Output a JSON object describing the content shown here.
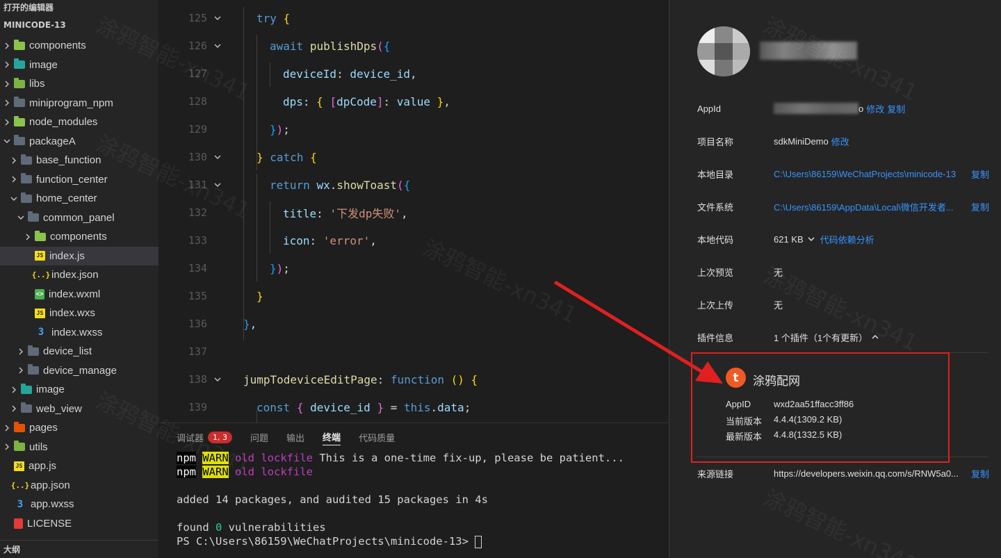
{
  "sidebar": {
    "open_editors": "打开的编辑器",
    "project": "MINICODE-13",
    "outline": "大纲",
    "tree": [
      {
        "label": "components",
        "depth": 0,
        "icon": "folder-green",
        "chev": "right"
      },
      {
        "label": "image",
        "depth": 0,
        "icon": "folder-teal",
        "chev": "right"
      },
      {
        "label": "libs",
        "depth": 0,
        "icon": "folder-lime",
        "chev": "right"
      },
      {
        "label": "miniprogram_npm",
        "depth": 0,
        "icon": "folder",
        "chev": "right"
      },
      {
        "label": "node_modules",
        "depth": 0,
        "icon": "folder-green",
        "chev": "right"
      },
      {
        "label": "packageA",
        "depth": 0,
        "icon": "folder",
        "chev": "down"
      },
      {
        "label": "base_function",
        "depth": 1,
        "icon": "folder",
        "chev": "right"
      },
      {
        "label": "function_center",
        "depth": 1,
        "icon": "folder",
        "chev": "right"
      },
      {
        "label": "home_center",
        "depth": 1,
        "icon": "folder",
        "chev": "down"
      },
      {
        "label": "common_panel",
        "depth": 2,
        "icon": "folder",
        "chev": "down"
      },
      {
        "label": "components",
        "depth": 3,
        "icon": "folder-green",
        "chev": "right"
      },
      {
        "label": "index.js",
        "depth": 3,
        "icon": "js",
        "chev": "none",
        "selected": true
      },
      {
        "label": "index.json",
        "depth": 3,
        "icon": "json",
        "chev": "none"
      },
      {
        "label": "index.wxml",
        "depth": 3,
        "icon": "wxml",
        "chev": "none"
      },
      {
        "label": "index.wxs",
        "depth": 3,
        "icon": "js",
        "chev": "none"
      },
      {
        "label": "index.wxss",
        "depth": 3,
        "icon": "css",
        "chev": "none"
      },
      {
        "label": "device_list",
        "depth": 2,
        "icon": "folder",
        "chev": "right"
      },
      {
        "label": "device_manage",
        "depth": 2,
        "icon": "folder",
        "chev": "right"
      },
      {
        "label": "image",
        "depth": 1,
        "icon": "folder-teal",
        "chev": "right"
      },
      {
        "label": "web_view",
        "depth": 1,
        "icon": "folder",
        "chev": "right"
      },
      {
        "label": "pages",
        "depth": 0,
        "icon": "folder-orange",
        "chev": "right"
      },
      {
        "label": "utils",
        "depth": 0,
        "icon": "folder-lime",
        "chev": "right"
      },
      {
        "label": "app.js",
        "depth": 0,
        "icon": "js",
        "chev": "none"
      },
      {
        "label": "app.json",
        "depth": 0,
        "icon": "json",
        "chev": "none"
      },
      {
        "label": "app.wxss",
        "depth": 0,
        "icon": "css",
        "chev": "none"
      },
      {
        "label": "LICENSE",
        "depth": 0,
        "icon": "license",
        "chev": "none"
      }
    ]
  },
  "editor": {
    "lines": [
      {
        "n": "125",
        "fold": true,
        "indent": 1,
        "tokens": [
          [
            "kw",
            "try"
          ],
          [
            "plain",
            " "
          ],
          [
            "br1",
            "{"
          ]
        ]
      },
      {
        "n": "126",
        "fold": true,
        "indent": 2,
        "tokens": [
          [
            "kw",
            "await"
          ],
          [
            "plain",
            " "
          ],
          [
            "fn",
            "publishDps"
          ],
          [
            "br2",
            "("
          ],
          [
            "br3",
            "{"
          ]
        ]
      },
      {
        "n": "127",
        "fold": false,
        "indent": 3,
        "tokens": [
          [
            "prop",
            "deviceId"
          ],
          [
            "plain",
            ": "
          ],
          [
            "prop",
            "device_id"
          ],
          [
            "plain",
            ","
          ]
        ]
      },
      {
        "n": "128",
        "fold": false,
        "indent": 3,
        "tokens": [
          [
            "prop",
            "dps"
          ],
          [
            "plain",
            ": "
          ],
          [
            "br1",
            "{"
          ],
          [
            "plain",
            " "
          ],
          [
            "br2",
            "["
          ],
          [
            "prop",
            "dpCode"
          ],
          [
            "br2",
            "]"
          ],
          [
            "plain",
            ": "
          ],
          [
            "prop",
            "value"
          ],
          [
            "plain",
            " "
          ],
          [
            "br1",
            "}"
          ],
          [
            "plain",
            ","
          ]
        ]
      },
      {
        "n": "129",
        "fold": false,
        "indent": 2,
        "tokens": [
          [
            "br3",
            "}"
          ],
          [
            "br2",
            ")"
          ],
          [
            "plain",
            ";"
          ]
        ]
      },
      {
        "n": "130",
        "fold": true,
        "indent": 1,
        "tokens": [
          [
            "br1",
            "}"
          ],
          [
            "plain",
            " "
          ],
          [
            "kw",
            "catch"
          ],
          [
            "plain",
            " "
          ],
          [
            "br1",
            "{"
          ]
        ]
      },
      {
        "n": "131",
        "fold": true,
        "indent": 2,
        "tokens": [
          [
            "kw",
            "return"
          ],
          [
            "plain",
            " "
          ],
          [
            "prop",
            "wx"
          ],
          [
            "plain",
            "."
          ],
          [
            "fn",
            "showToast"
          ],
          [
            "br2",
            "("
          ],
          [
            "br3",
            "{"
          ]
        ]
      },
      {
        "n": "132",
        "fold": false,
        "indent": 3,
        "tokens": [
          [
            "prop",
            "title"
          ],
          [
            "plain",
            ": "
          ],
          [
            "str",
            "'下发dp失败'"
          ],
          [
            "plain",
            ","
          ]
        ]
      },
      {
        "n": "133",
        "fold": false,
        "indent": 3,
        "tokens": [
          [
            "prop",
            "icon"
          ],
          [
            "plain",
            ": "
          ],
          [
            "str",
            "'error'"
          ],
          [
            "plain",
            ","
          ]
        ]
      },
      {
        "n": "134",
        "fold": false,
        "indent": 2,
        "tokens": [
          [
            "br3",
            "}"
          ],
          [
            "br2",
            ")"
          ],
          [
            "plain",
            ";"
          ]
        ]
      },
      {
        "n": "135",
        "fold": false,
        "indent": 1,
        "tokens": [
          [
            "br1",
            "}"
          ]
        ]
      },
      {
        "n": "136",
        "fold": false,
        "indent": 0,
        "tokens": [
          [
            "br3",
            "}"
          ],
          [
            "plain",
            ","
          ]
        ]
      },
      {
        "n": "137",
        "fold": false,
        "indent": 0,
        "tokens": []
      },
      {
        "n": "138",
        "fold": true,
        "indent": 0,
        "tokens": [
          [
            "fn",
            "jumpTodeviceEditPage"
          ],
          [
            "plain",
            ": "
          ],
          [
            "kw",
            "function"
          ],
          [
            "plain",
            " "
          ],
          [
            "br1",
            "()"
          ],
          [
            "plain",
            " "
          ],
          [
            "br1",
            "{"
          ]
        ]
      },
      {
        "n": "139",
        "fold": false,
        "indent": 1,
        "tokens": [
          [
            "kw",
            "const"
          ],
          [
            "plain",
            " "
          ],
          [
            "br2",
            "{"
          ],
          [
            "plain",
            " "
          ],
          [
            "prop",
            "device_id"
          ],
          [
            "plain",
            " "
          ],
          [
            "br2",
            "}"
          ],
          [
            "plain",
            " = "
          ],
          [
            "kw",
            "this"
          ],
          [
            "plain",
            "."
          ],
          [
            "prop",
            "data"
          ],
          [
            "plain",
            ";"
          ]
        ]
      }
    ]
  },
  "panel": {
    "tabs": [
      {
        "label": "调试器",
        "badge": "1, 3"
      },
      {
        "label": "问题"
      },
      {
        "label": "输出"
      },
      {
        "label": "终端",
        "active": true
      },
      {
        "label": "代码质量"
      }
    ],
    "terminal": {
      "l1_npm": "npm",
      "l1_warn": "WARN",
      "l1_tag": "old lockfile",
      "l1_msg": " This is a one-time fix-up, please be patient...",
      "l2_npm": "npm",
      "l2_warn": "WARN",
      "l2_tag": "old lockfile",
      "l3": "added 14 packages, and audited 15 packages in 4s",
      "l4_a": "found ",
      "l4_b": "0",
      "l4_c": " vulnerabilities",
      "l5": "PS C:\\Users\\86159\\WeChatProjects\\minicode-13> "
    }
  },
  "details": {
    "appid_label": "AppId",
    "appid_suffix": "o",
    "edit": "修改",
    "copy": "复制",
    "name_label": "项目名称",
    "name_value": "sdkMiniDemo",
    "dir_label": "本地目录",
    "dir_value": "C:\\Users\\86159\\WeChatProjects\\minicode-13",
    "fs_label": "文件系统",
    "fs_value": "C:\\Users\\86159\\AppData\\Local\\微信开发者...",
    "code_label": "本地代码",
    "code_value": "621 KB",
    "code_link": "代码依赖分析",
    "preview_label": "上次预览",
    "preview_value": "无",
    "upload_label": "上次上传",
    "upload_value": "无",
    "plugin_label": "插件信息",
    "plugin_value": "1 个插件（1个有更新）",
    "plugin": {
      "logo": "t",
      "name": "涂鸦配网",
      "appid_label": "AppID",
      "appid_value": "wxd2aa51ffacc3ff86",
      "cur_label": "当前版本",
      "cur_value": "4.4.4(1309.2 KB)",
      "new_label": "最新版本",
      "new_value": "4.4.8(1332.5 KB)"
    },
    "source_label": "来源链接",
    "source_value": "https://developers.weixin.qq.com/s/RNW5a0..."
  },
  "watermark": "涂鸦智能-xn341",
  "colors": {
    "highlight": "#e02020",
    "link": "#3794ff",
    "plugin_brand": "#f15a24"
  }
}
